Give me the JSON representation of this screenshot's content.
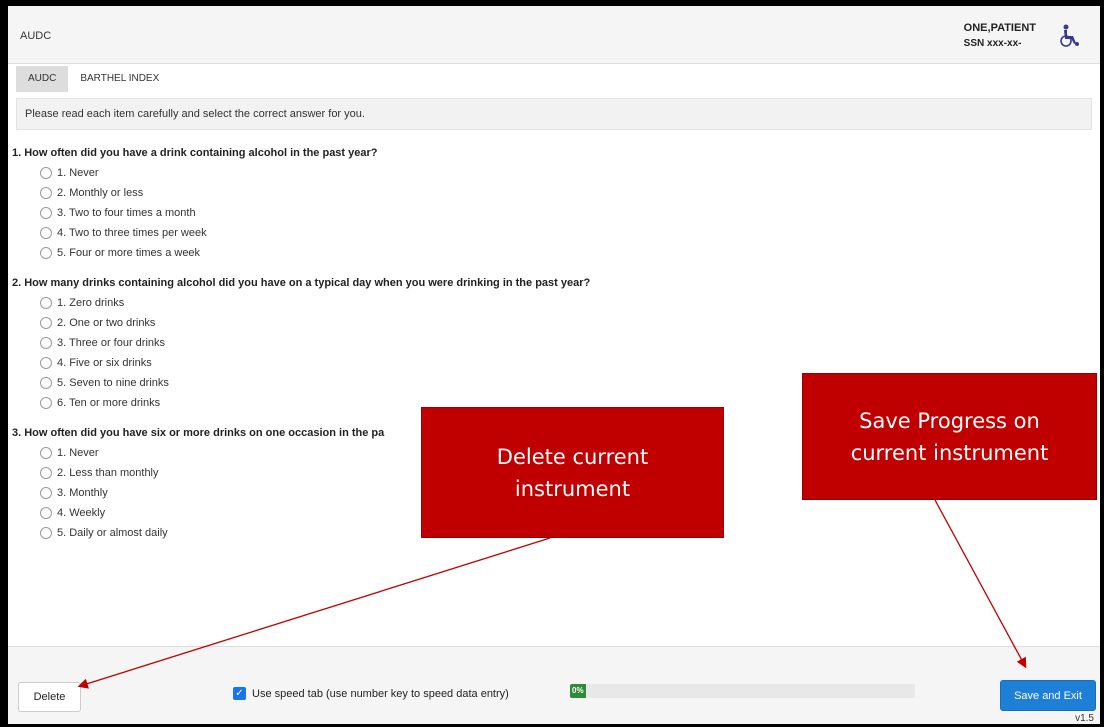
{
  "header": {
    "title": "AUDC",
    "patient_name": "ONE,PATIENT",
    "patient_ssn": "SSN xxx-xx-",
    "accessibility_icon": "wheelchair-icon"
  },
  "tabs": [
    {
      "label": "AUDC",
      "active": true
    },
    {
      "label": "BARTHEL INDEX",
      "active": false
    }
  ],
  "instructions": "Please read each item carefully and select the correct answer for you.",
  "questions": [
    {
      "text": "1. How often did you have a drink containing alcohol in the past year?",
      "options": [
        "1. Never",
        "2. Monthly or less",
        "3. Two to four times a month",
        "4. Two to three times per week",
        "5. Four or more times a week"
      ]
    },
    {
      "text": "2. How many drinks containing alcohol did you have on a typical day when you were drinking in the past year?",
      "options": [
        "1. Zero drinks",
        "2. One or two drinks",
        "3. Three or four drinks",
        "4. Five or six drinks",
        "5. Seven to nine drinks",
        "6. Ten or more drinks"
      ]
    },
    {
      "text": "3. How often did you have six or more drinks on one occasion in the pa",
      "options": [
        "1. Never",
        "2. Less than monthly",
        "3. Monthly",
        "4. Weekly",
        "5. Daily or almost daily"
      ]
    }
  ],
  "footer": {
    "delete_label": "Delete",
    "speed_tab_label": "Use speed tab (use number key to speed data entry)",
    "speed_tab_checked": true,
    "progress_text": "0%",
    "progress_value": 0,
    "save_label": "Save and Exit",
    "version": "v1.5"
  },
  "callouts": {
    "delete": "Delete current instrument",
    "save": "Save Progress on current instrument"
  },
  "colors": {
    "callout": "#c00000",
    "primary": "#1e7fd6",
    "progress": "#2e8b3a"
  }
}
